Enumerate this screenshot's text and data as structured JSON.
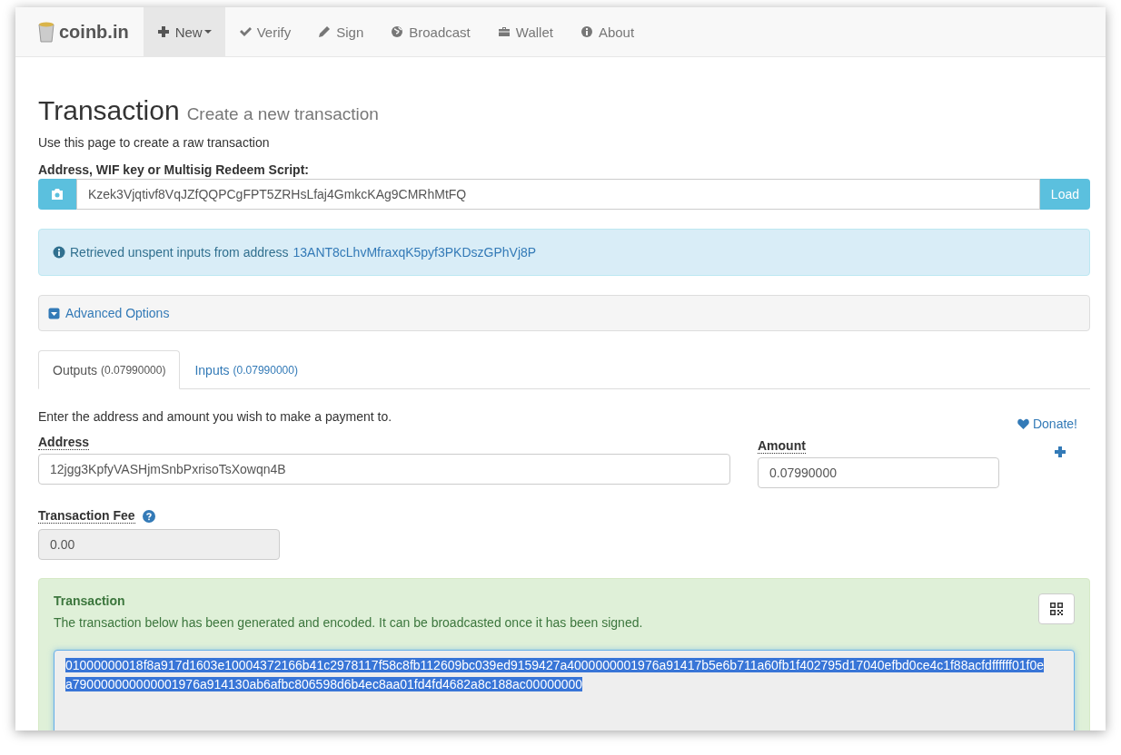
{
  "navbar": {
    "brand": "coinb.in",
    "items": [
      {
        "label": "New",
        "caret": true,
        "selected": true
      },
      {
        "label": "Verify",
        "caret": false,
        "selected": false
      },
      {
        "label": "Sign",
        "caret": false,
        "selected": false
      },
      {
        "label": "Broadcast",
        "caret": false,
        "selected": false
      },
      {
        "label": "Wallet",
        "caret": false,
        "selected": false
      },
      {
        "label": "About",
        "caret": false,
        "selected": false
      }
    ]
  },
  "heading": {
    "title": "Transaction",
    "subtitle": "Create a new transaction"
  },
  "intro": "Use this page to create a raw transaction",
  "address_field": {
    "label": "Address, WIF key or Multisig Redeem Script:",
    "value": "Kzek3Vjqtivf8VqJZfQQPCgFPT5ZRHsLfaj4GmkcKAg9CMRhMtFQ",
    "button": "Load"
  },
  "alert": {
    "text": "Retrieved unspent inputs from address",
    "link": "13ANT8cLhvMfraxqK5pyf3PKDszGPhVj8P"
  },
  "advanced": {
    "label": "Advanced Options",
    "expanded": false
  },
  "tabs": [
    {
      "label": "Outputs",
      "amount": "(0.07990000)",
      "selected": true
    },
    {
      "label": "Inputs",
      "amount": "(0.07990000)",
      "selected": false
    }
  ],
  "outputs": {
    "instruction": "Enter the address and amount you wish to make a payment to.",
    "donate": "Donate!",
    "address_label": "Address",
    "address_value": "12jgg3KpfyVASHjmSnbPxrisoTsXowqn4B",
    "amount_label": "Amount",
    "amount_value": "0.07990000"
  },
  "fee": {
    "label": "Transaction Fee",
    "value": "0.00"
  },
  "result": {
    "title": "Transaction",
    "text": "The transaction below has been generated and encoded. It can be broadcasted once it has been signed.",
    "lines": [
      "01000000018f8a917d1603e10004372166b41c2978117f58c8fb112609bc039ed9159427a4000000001976a91417b5e6b711a60fb1f402795d17040efbd0ce4c1f88acfdffffff01f0e",
      "a790000000000001976a914130ab6afbc806598d6b4ec8aa01fd4fd4682a8c188ac00000000"
    ],
    "selected": true
  }
}
